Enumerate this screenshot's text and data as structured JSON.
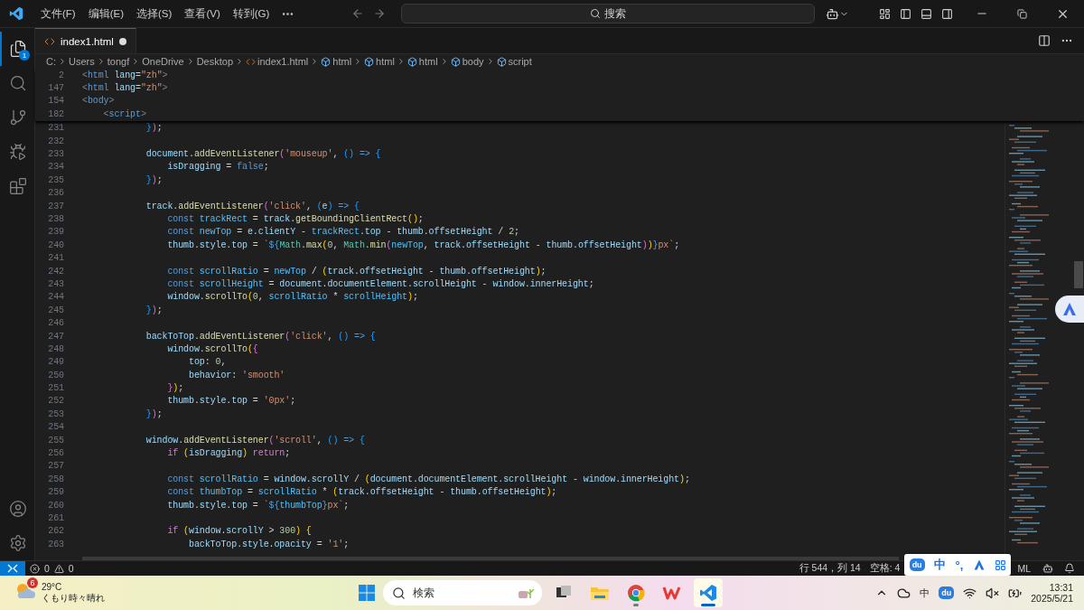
{
  "title_bar": {
    "menus": [
      "文件(F)",
      "编辑(E)",
      "选择(S)",
      "查看(V)",
      "转到(G)"
    ],
    "search": {
      "label": "搜索"
    }
  },
  "activity_bar": {
    "items": [
      {
        "kind": "explorer",
        "selected": true,
        "badge": "1"
      },
      {
        "kind": "search",
        "selected": false
      },
      {
        "kind": "source-control",
        "selected": false
      },
      {
        "kind": "run",
        "selected": false
      },
      {
        "kind": "extensions",
        "selected": false
      }
    ],
    "bottom": [
      {
        "kind": "account"
      },
      {
        "kind": "settings"
      }
    ]
  },
  "tabs": [
    {
      "label": "index1.html",
      "selected": true,
      "modified": true
    }
  ],
  "breadcrumbs": [
    {
      "label": "C:",
      "kind": "folder"
    },
    {
      "label": "Users",
      "kind": "folder"
    },
    {
      "label": "tongf",
      "kind": "folder"
    },
    {
      "label": "OneDrive",
      "kind": "folder"
    },
    {
      "label": "Desktop",
      "kind": "folder"
    },
    {
      "label": "index1.html",
      "kind": "file"
    },
    {
      "label": "html",
      "kind": "symbol"
    },
    {
      "label": "html",
      "kind": "symbol"
    },
    {
      "label": "html",
      "kind": "symbol"
    },
    {
      "label": "body",
      "kind": "symbol"
    },
    {
      "label": "script",
      "kind": "symbol"
    }
  ],
  "sticky_lines": [
    {
      "n": "2",
      "tokens": [
        {
          "kind": "punct",
          "text": "<"
        },
        {
          "kind": "kw",
          "text": "html"
        },
        {
          "kind": "var",
          "text": " lang"
        },
        {
          "kind": "plain",
          "text": "="
        },
        {
          "kind": "str",
          "text": "\"zh\""
        },
        {
          "kind": "punct",
          "text": ">"
        }
      ]
    },
    {
      "n": "147",
      "tokens": [
        {
          "kind": "punct",
          "text": "<"
        },
        {
          "kind": "kw",
          "text": "html"
        },
        {
          "kind": "var",
          "text": " lang"
        },
        {
          "kind": "plain",
          "text": "="
        },
        {
          "kind": "str",
          "text": "\"zh\""
        },
        {
          "kind": "punct",
          "text": ">"
        }
      ]
    },
    {
      "n": "154",
      "tokens": [
        {
          "kind": "punct",
          "text": "<"
        },
        {
          "kind": "kw",
          "text": "body"
        },
        {
          "kind": "punct",
          "text": ">"
        }
      ]
    },
    {
      "n": "182",
      "tokens": [
        {
          "kind": "punct",
          "text": "    <"
        },
        {
          "kind": "kw",
          "text": "script"
        },
        {
          "kind": "punct",
          "text": ">"
        }
      ]
    }
  ],
  "code_lines": [
    {
      "n": "231",
      "tokens": [
        {
          "kind": "br3",
          "text": "            }"
        },
        {
          "kind": "br2",
          "text": ")"
        },
        {
          "kind": "plain",
          "text": ";"
        }
      ]
    },
    {
      "n": "232"
    },
    {
      "n": "233",
      "tokens": [
        {
          "kind": "var",
          "text": "            document"
        },
        {
          "kind": "plain",
          "text": "."
        },
        {
          "kind": "func",
          "text": "addEventListener"
        },
        {
          "kind": "br2",
          "text": "("
        },
        {
          "kind": "str",
          "text": "'mouseup'"
        },
        {
          "kind": "plain",
          "text": ","
        },
        {
          "kind": "br3",
          "text": " ()"
        },
        {
          "kind": "kw",
          "text": " =>"
        },
        {
          "kind": "br3",
          "text": " {"
        }
      ]
    },
    {
      "n": "234",
      "tokens": [
        {
          "kind": "var",
          "text": "                isDragging"
        },
        {
          "kind": "plain",
          "text": " = "
        },
        {
          "kind": "kw",
          "text": "false"
        },
        {
          "kind": "plain",
          "text": ";"
        }
      ]
    },
    {
      "n": "235",
      "tokens": [
        {
          "kind": "br3",
          "text": "            }"
        },
        {
          "kind": "br2",
          "text": ")"
        },
        {
          "kind": "plain",
          "text": ";"
        }
      ]
    },
    {
      "n": "236"
    },
    {
      "n": "237",
      "tokens": [
        {
          "kind": "var",
          "text": "            track"
        },
        {
          "kind": "plain",
          "text": "."
        },
        {
          "kind": "func",
          "text": "addEventListener"
        },
        {
          "kind": "br2",
          "text": "("
        },
        {
          "kind": "str",
          "text": "'click'"
        },
        {
          "kind": "plain",
          "text": ","
        },
        {
          "kind": "br3",
          "text": " ("
        },
        {
          "kind": "var",
          "text": "e"
        },
        {
          "kind": "br3",
          "text": ")"
        },
        {
          "kind": "kw",
          "text": " =>"
        },
        {
          "kind": "br3",
          "text": " {"
        }
      ]
    },
    {
      "n": "238",
      "tokens": [
        {
          "kind": "kw",
          "text": "                const"
        },
        {
          "kind": "const",
          "text": " trackRect"
        },
        {
          "kind": "plain",
          "text": " = "
        },
        {
          "kind": "var",
          "text": "track"
        },
        {
          "kind": "plain",
          "text": "."
        },
        {
          "kind": "func",
          "text": "getBoundingClientRect"
        },
        {
          "kind": "br1",
          "text": "()"
        },
        {
          "kind": "plain",
          "text": ";"
        }
      ]
    },
    {
      "n": "239",
      "tokens": [
        {
          "kind": "kw",
          "text": "                const"
        },
        {
          "kind": "const",
          "text": " newTop"
        },
        {
          "kind": "plain",
          "text": " = "
        },
        {
          "kind": "var",
          "text": "e"
        },
        {
          "kind": "plain",
          "text": "."
        },
        {
          "kind": "var",
          "text": "clientY"
        },
        {
          "kind": "plain",
          "text": " - "
        },
        {
          "kind": "const",
          "text": "trackRect"
        },
        {
          "kind": "plain",
          "text": "."
        },
        {
          "kind": "var",
          "text": "top"
        },
        {
          "kind": "plain",
          "text": " - "
        },
        {
          "kind": "var",
          "text": "thumb"
        },
        {
          "kind": "plain",
          "text": "."
        },
        {
          "kind": "var",
          "text": "offsetHeight"
        },
        {
          "kind": "plain",
          "text": " / "
        },
        {
          "kind": "num",
          "text": "2"
        },
        {
          "kind": "plain",
          "text": ";"
        }
      ]
    },
    {
      "n": "240",
      "tokens": [
        {
          "kind": "var",
          "text": "                thumb"
        },
        {
          "kind": "plain",
          "text": "."
        },
        {
          "kind": "var",
          "text": "style"
        },
        {
          "kind": "plain",
          "text": "."
        },
        {
          "kind": "var",
          "text": "top"
        },
        {
          "kind": "plain",
          "text": " = "
        },
        {
          "kind": "str",
          "text": "`"
        },
        {
          "kind": "kw",
          "text": "${"
        },
        {
          "kind": "type",
          "text": "Math"
        },
        {
          "kind": "plain",
          "text": "."
        },
        {
          "kind": "func",
          "text": "max"
        },
        {
          "kind": "br1",
          "text": "("
        },
        {
          "kind": "num",
          "text": "0"
        },
        {
          "kind": "plain",
          "text": ","
        },
        {
          "kind": "type",
          "text": " Math"
        },
        {
          "kind": "plain",
          "text": "."
        },
        {
          "kind": "func",
          "text": "min"
        },
        {
          "kind": "br2",
          "text": "("
        },
        {
          "kind": "const",
          "text": "newTop"
        },
        {
          "kind": "plain",
          "text": ","
        },
        {
          "kind": "var",
          "text": " track"
        },
        {
          "kind": "plain",
          "text": "."
        },
        {
          "kind": "var",
          "text": "offsetHeight"
        },
        {
          "kind": "plain",
          "text": " - "
        },
        {
          "kind": "var",
          "text": "thumb"
        },
        {
          "kind": "plain",
          "text": "."
        },
        {
          "kind": "var",
          "text": "offsetHeight"
        },
        {
          "kind": "br2",
          "text": ")"
        },
        {
          "kind": "br1",
          "text": ")"
        },
        {
          "kind": "kw",
          "text": "}"
        },
        {
          "kind": "str",
          "text": "px`"
        },
        {
          "kind": "plain",
          "text": ";"
        }
      ]
    },
    {
      "n": "241"
    },
    {
      "n": "242",
      "tokens": [
        {
          "kind": "kw",
          "text": "                const"
        },
        {
          "kind": "const",
          "text": " scrollRatio"
        },
        {
          "kind": "plain",
          "text": " = "
        },
        {
          "kind": "const",
          "text": "newTop"
        },
        {
          "kind": "plain",
          "text": " / "
        },
        {
          "kind": "br1",
          "text": "("
        },
        {
          "kind": "var",
          "text": "track"
        },
        {
          "kind": "plain",
          "text": "."
        },
        {
          "kind": "var",
          "text": "offsetHeight"
        },
        {
          "kind": "plain",
          "text": " - "
        },
        {
          "kind": "var",
          "text": "thumb"
        },
        {
          "kind": "plain",
          "text": "."
        },
        {
          "kind": "var",
          "text": "offsetHeight"
        },
        {
          "kind": "br1",
          "text": ")"
        },
        {
          "kind": "plain",
          "text": ";"
        }
      ]
    },
    {
      "n": "243",
      "tokens": [
        {
          "kind": "kw",
          "text": "                const"
        },
        {
          "kind": "const",
          "text": " scrollHeight"
        },
        {
          "kind": "plain",
          "text": " = "
        },
        {
          "kind": "var",
          "text": "document"
        },
        {
          "kind": "plain",
          "text": "."
        },
        {
          "kind": "var",
          "text": "documentElement"
        },
        {
          "kind": "plain",
          "text": "."
        },
        {
          "kind": "var",
          "text": "scrollHeight"
        },
        {
          "kind": "plain",
          "text": " - "
        },
        {
          "kind": "var",
          "text": "window"
        },
        {
          "kind": "plain",
          "text": "."
        },
        {
          "kind": "var",
          "text": "innerHeight"
        },
        {
          "kind": "plain",
          "text": ";"
        }
      ]
    },
    {
      "n": "244",
      "tokens": [
        {
          "kind": "var",
          "text": "                window"
        },
        {
          "kind": "plain",
          "text": "."
        },
        {
          "kind": "func",
          "text": "scrollTo"
        },
        {
          "kind": "br1",
          "text": "("
        },
        {
          "kind": "num",
          "text": "0"
        },
        {
          "kind": "plain",
          "text": ","
        },
        {
          "kind": "const",
          "text": " scrollRatio"
        },
        {
          "kind": "plain",
          "text": " * "
        },
        {
          "kind": "const",
          "text": "scrollHeight"
        },
        {
          "kind": "br1",
          "text": ")"
        },
        {
          "kind": "plain",
          "text": ";"
        }
      ]
    },
    {
      "n": "245",
      "tokens": [
        {
          "kind": "br3",
          "text": "            }"
        },
        {
          "kind": "br2",
          "text": ")"
        },
        {
          "kind": "plain",
          "text": ";"
        }
      ]
    },
    {
      "n": "246"
    },
    {
      "n": "247",
      "tokens": [
        {
          "kind": "var",
          "text": "            backToTop"
        },
        {
          "kind": "plain",
          "text": "."
        },
        {
          "kind": "func",
          "text": "addEventListener"
        },
        {
          "kind": "br2",
          "text": "("
        },
        {
          "kind": "str",
          "text": "'click'"
        },
        {
          "kind": "plain",
          "text": ","
        },
        {
          "kind": "br3",
          "text": " ()"
        },
        {
          "kind": "kw",
          "text": " =>"
        },
        {
          "kind": "br3",
          "text": " {"
        }
      ]
    },
    {
      "n": "248",
      "tokens": [
        {
          "kind": "var",
          "text": "                window"
        },
        {
          "kind": "plain",
          "text": "."
        },
        {
          "kind": "func",
          "text": "scrollTo"
        },
        {
          "kind": "br1",
          "text": "("
        },
        {
          "kind": "br2",
          "text": "{"
        }
      ]
    },
    {
      "n": "249",
      "tokens": [
        {
          "kind": "var",
          "text": "                    top"
        },
        {
          "kind": "plain",
          "text": ":"
        },
        {
          "kind": "num",
          "text": " 0"
        },
        {
          "kind": "plain",
          "text": ","
        }
      ]
    },
    {
      "n": "250",
      "tokens": [
        {
          "kind": "var",
          "text": "                    behavior"
        },
        {
          "kind": "plain",
          "text": ":"
        },
        {
          "kind": "str",
          "text": " 'smooth'"
        }
      ]
    },
    {
      "n": "251",
      "tokens": [
        {
          "kind": "br2",
          "text": "                }"
        },
        {
          "kind": "br1",
          "text": ")"
        },
        {
          "kind": "plain",
          "text": ";"
        }
      ]
    },
    {
      "n": "252",
      "tokens": [
        {
          "kind": "var",
          "text": "                thumb"
        },
        {
          "kind": "plain",
          "text": "."
        },
        {
          "kind": "var",
          "text": "style"
        },
        {
          "kind": "plain",
          "text": "."
        },
        {
          "kind": "var",
          "text": "top"
        },
        {
          "kind": "plain",
          "text": " = "
        },
        {
          "kind": "str",
          "text": "'0px'"
        },
        {
          "kind": "plain",
          "text": ";"
        }
      ]
    },
    {
      "n": "253",
      "tokens": [
        {
          "kind": "br3",
          "text": "            }"
        },
        {
          "kind": "br2",
          "text": ")"
        },
        {
          "kind": "plain",
          "text": ";"
        }
      ]
    },
    {
      "n": "254"
    },
    {
      "n": "255",
      "tokens": [
        {
          "kind": "var",
          "text": "            window"
        },
        {
          "kind": "plain",
          "text": "."
        },
        {
          "kind": "func",
          "text": "addEventListener"
        },
        {
          "kind": "br2",
          "text": "("
        },
        {
          "kind": "str",
          "text": "'scroll'"
        },
        {
          "kind": "plain",
          "text": ","
        },
        {
          "kind": "br3",
          "text": " ()"
        },
        {
          "kind": "kw",
          "text": " =>"
        },
        {
          "kind": "br3",
          "text": " {"
        }
      ]
    },
    {
      "n": "256",
      "tokens": [
        {
          "kind": "ctrl",
          "text": "                if"
        },
        {
          "kind": "br1",
          "text": " ("
        },
        {
          "kind": "var",
          "text": "isDragging"
        },
        {
          "kind": "br1",
          "text": ")"
        },
        {
          "kind": "ctrl",
          "text": " return"
        },
        {
          "kind": "plain",
          "text": ";"
        }
      ]
    },
    {
      "n": "257"
    },
    {
      "n": "258",
      "tokens": [
        {
          "kind": "kw",
          "text": "                const"
        },
        {
          "kind": "const",
          "text": " scrollRatio"
        },
        {
          "kind": "plain",
          "text": " = "
        },
        {
          "kind": "var",
          "text": "window"
        },
        {
          "kind": "plain",
          "text": "."
        },
        {
          "kind": "var",
          "text": "scrollY"
        },
        {
          "kind": "plain",
          "text": " / "
        },
        {
          "kind": "br1",
          "text": "("
        },
        {
          "kind": "var",
          "text": "document"
        },
        {
          "kind": "plain",
          "text": "."
        },
        {
          "kind": "var",
          "text": "documentElement"
        },
        {
          "kind": "plain",
          "text": "."
        },
        {
          "kind": "var",
          "text": "scrollHeight"
        },
        {
          "kind": "plain",
          "text": " - "
        },
        {
          "kind": "var",
          "text": "window"
        },
        {
          "kind": "plain",
          "text": "."
        },
        {
          "kind": "var",
          "text": "innerHeight"
        },
        {
          "kind": "br1",
          "text": ")"
        },
        {
          "kind": "plain",
          "text": ";"
        }
      ]
    },
    {
      "n": "259",
      "tokens": [
        {
          "kind": "kw",
          "text": "                const"
        },
        {
          "kind": "const",
          "text": " thumbTop"
        },
        {
          "kind": "plain",
          "text": " = "
        },
        {
          "kind": "const",
          "text": "scrollRatio"
        },
        {
          "kind": "plain",
          "text": " * "
        },
        {
          "kind": "br1",
          "text": "("
        },
        {
          "kind": "var",
          "text": "track"
        },
        {
          "kind": "plain",
          "text": "."
        },
        {
          "kind": "var",
          "text": "offsetHeight"
        },
        {
          "kind": "plain",
          "text": " - "
        },
        {
          "kind": "var",
          "text": "thumb"
        },
        {
          "kind": "plain",
          "text": "."
        },
        {
          "kind": "var",
          "text": "offsetHeight"
        },
        {
          "kind": "br1",
          "text": ")"
        },
        {
          "kind": "plain",
          "text": ";"
        }
      ]
    },
    {
      "n": "260",
      "tokens": [
        {
          "kind": "var",
          "text": "                thumb"
        },
        {
          "kind": "plain",
          "text": "."
        },
        {
          "kind": "var",
          "text": "style"
        },
        {
          "kind": "plain",
          "text": "."
        },
        {
          "kind": "var",
          "text": "top"
        },
        {
          "kind": "plain",
          "text": " = "
        },
        {
          "kind": "str",
          "text": "`"
        },
        {
          "kind": "kw",
          "text": "${"
        },
        {
          "kind": "const",
          "text": "thumbTop"
        },
        {
          "kind": "kw",
          "text": "}"
        },
        {
          "kind": "str",
          "text": "px`"
        },
        {
          "kind": "plain",
          "text": ";"
        }
      ]
    },
    {
      "n": "261"
    },
    {
      "n": "262",
      "tokens": [
        {
          "kind": "ctrl",
          "text": "                if"
        },
        {
          "kind": "br1",
          "text": " ("
        },
        {
          "kind": "var",
          "text": "window"
        },
        {
          "kind": "plain",
          "text": "."
        },
        {
          "kind": "var",
          "text": "scrollY"
        },
        {
          "kind": "plain",
          "text": " > "
        },
        {
          "kind": "num",
          "text": "300"
        },
        {
          "kind": "br1",
          "text": ")"
        },
        {
          "kind": "br1",
          "text": " {"
        }
      ]
    },
    {
      "n": "263",
      "tokens": [
        {
          "kind": "var",
          "text": "                    backToTop"
        },
        {
          "kind": "plain",
          "text": "."
        },
        {
          "kind": "var",
          "text": "style"
        },
        {
          "kind": "plain",
          "text": "."
        },
        {
          "kind": "var",
          "text": "opacity"
        },
        {
          "kind": "plain",
          "text": " = "
        },
        {
          "kind": "str",
          "text": "'1'"
        },
        {
          "kind": "plain",
          "text": ";"
        }
      ]
    }
  ],
  "status_bar": {
    "errors": "0",
    "warnings": "0",
    "position": "行 544，列 14",
    "spaces": "空格: 4",
    "language": "ML"
  },
  "ime_toolbar": {
    "logo": "du",
    "mode": "中",
    "punctuation": "°,"
  },
  "taskbar": {
    "weather": {
      "badge": "6",
      "temperature": "29°C",
      "condition": "くもり時々晴れ"
    },
    "search": {
      "placeholder": "検索"
    },
    "apps": [
      {
        "kind": "task-view",
        "selected": false,
        "running": false
      },
      {
        "kind": "files",
        "selected": false,
        "running": false
      },
      {
        "kind": "browser",
        "selected": false,
        "running": true
      },
      {
        "kind": "office",
        "selected": false,
        "running": false
      },
      {
        "kind": "editor",
        "selected": true,
        "running": true
      }
    ],
    "tray": {
      "ime": "中",
      "app_logo": "du"
    },
    "time": "13:31",
    "date": "2025/5/21"
  }
}
